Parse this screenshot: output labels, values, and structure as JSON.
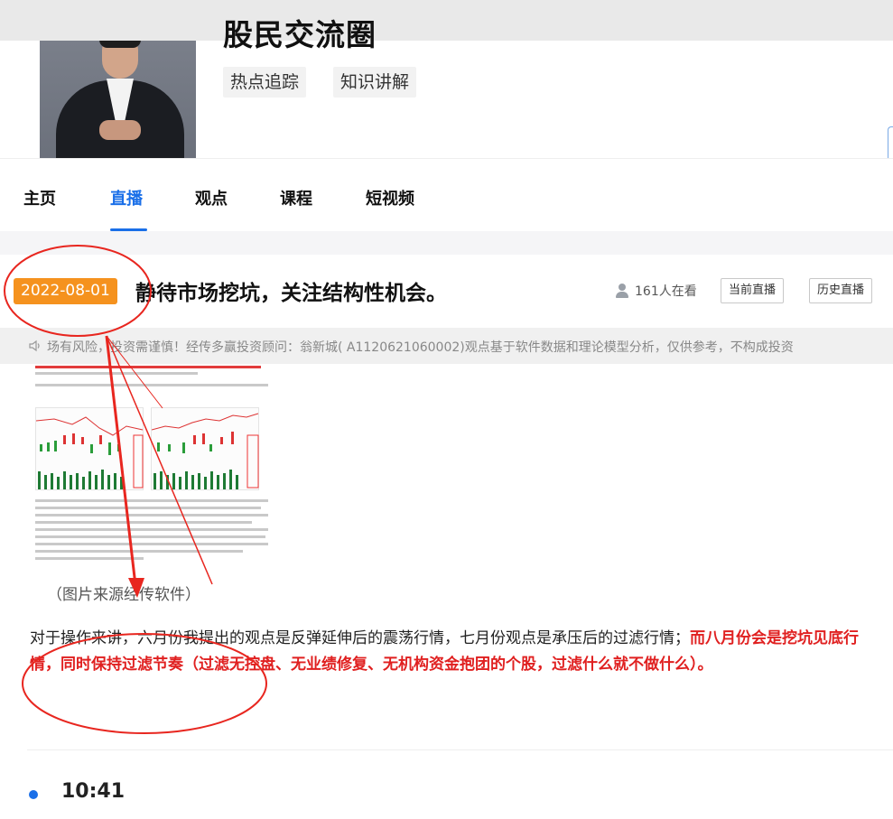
{
  "header": {
    "group_title": "股民交流圈",
    "tags": [
      "热点追踪",
      "知识讲解"
    ]
  },
  "tabs": [
    {
      "label": "主页",
      "active": false
    },
    {
      "label": "直播",
      "active": true
    },
    {
      "label": "观点",
      "active": false
    },
    {
      "label": "课程",
      "active": false
    },
    {
      "label": "短视频",
      "active": false
    }
  ],
  "live": {
    "date": "2022-08-01",
    "title": "静待市场挖坑，关注结构性机会。",
    "viewers": "161人在看",
    "current_label": "当前直播",
    "history_label": "历史直播"
  },
  "notice": {
    "text": "场有风险，投资需谨慎！经传多赢投资顾问：翁新城( A1120621060002)观点基于软件数据和理论模型分析，仅供参考，不构成投资"
  },
  "post": {
    "image_caption": "（图片来源经传软件）",
    "paragraph_plain": "对于操作来讲，六月份我提出的观点是反弹延伸后的震荡行情，七月份观点是承压后的过滤行情；",
    "paragraph_highlight": "而八月份会是挖坑见底行情，同时保持过滤节奏（过滤无控盘、无业绩修复、无机构资金抱团的个股，过滤什么就不做什么）。"
  },
  "timeline": {
    "time": "10:41"
  },
  "colors": {
    "accent": "#1a6fe8",
    "date_badge": "#f5921e",
    "highlight_text": "#e02020",
    "annotation": "#e8261f"
  }
}
